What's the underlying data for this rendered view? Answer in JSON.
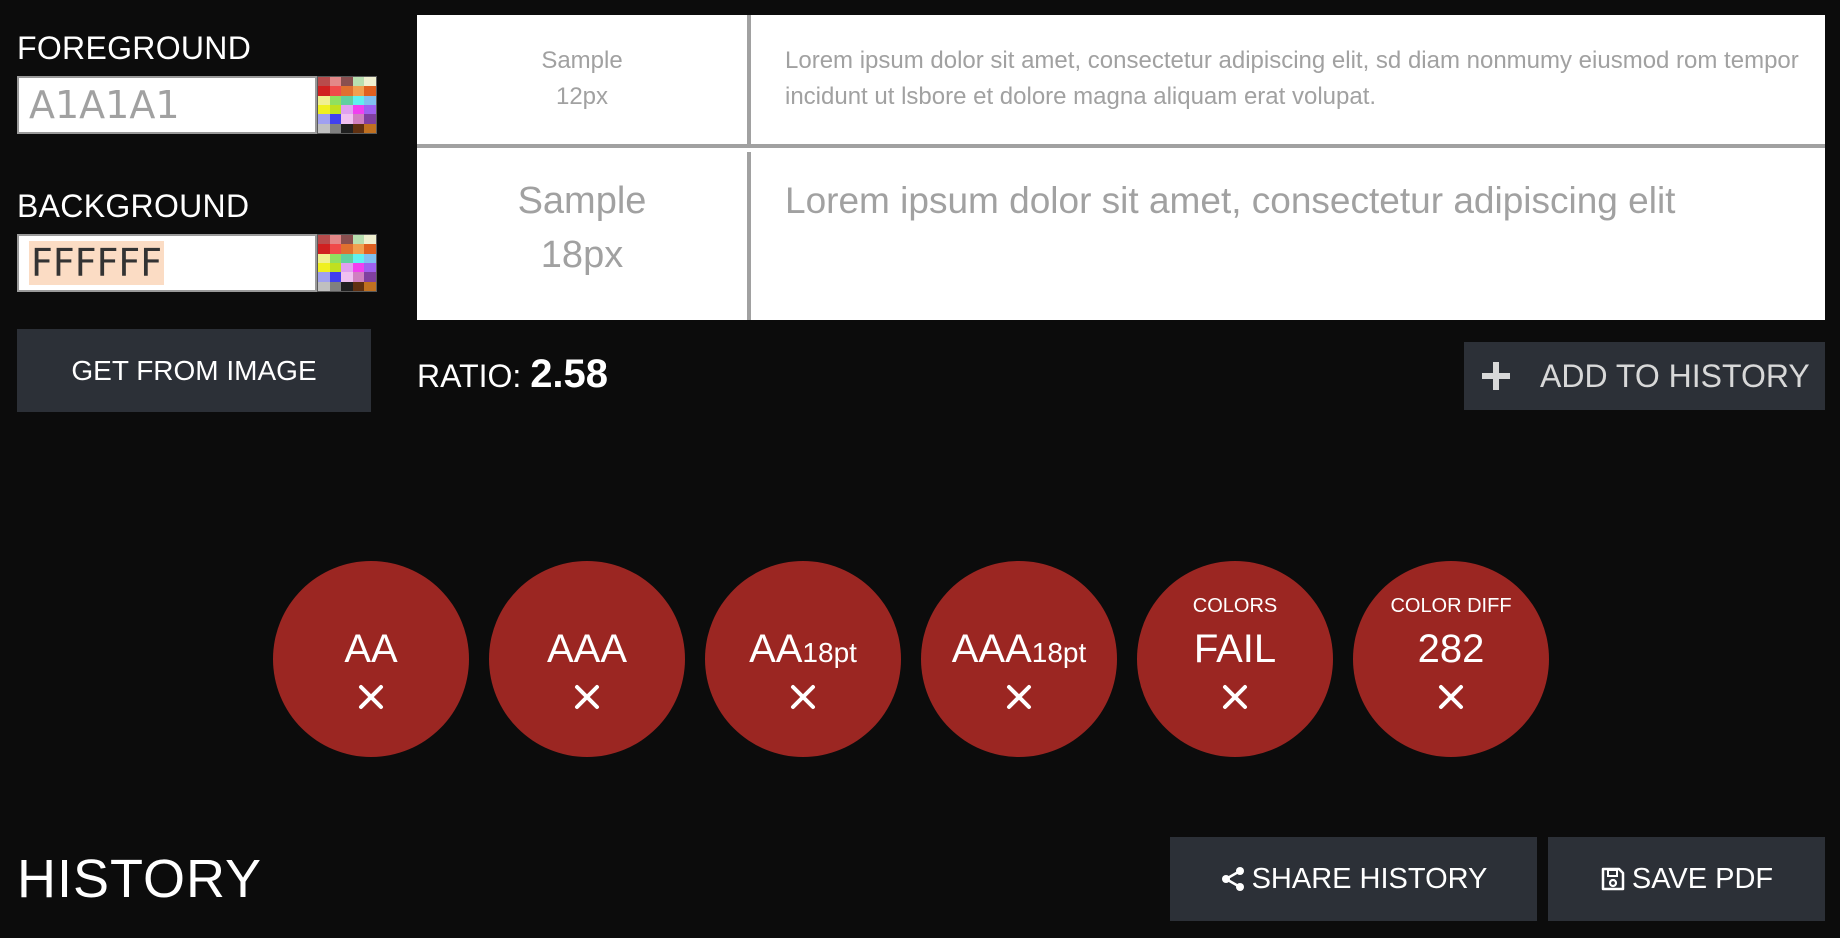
{
  "foreground": {
    "label": "FOREGROUND",
    "value": "A1A1A1"
  },
  "background": {
    "label": "BACKGROUND",
    "value": "FFFFFF"
  },
  "get_from_image_label": "GET FROM IMAGE",
  "samples": {
    "small": {
      "label_line1": "Sample",
      "label_line2": "12px",
      "text": "Lorem ipsum dolor sit amet, consectetur adipiscing elit, sd diam nonmumy eiusmod rom tempor incidunt ut lsbore et dolore magna aliquam erat volupat."
    },
    "large": {
      "label_line1": "Sample",
      "label_line2": "18px",
      "text": "Lorem ipsum dolor sit amet, consectetur adipiscing elit"
    }
  },
  "ratio": {
    "label": "RATIO:",
    "value": "2.58"
  },
  "add_history_label": "ADD TO HISTORY",
  "results": [
    {
      "main": "AA",
      "sub": "",
      "small": "",
      "status_icon": "x-icon"
    },
    {
      "main": "AAA",
      "sub": "",
      "small": "",
      "status_icon": "x-icon"
    },
    {
      "main": "AA",
      "sub": "18pt",
      "small": "",
      "status_icon": "x-icon"
    },
    {
      "main": "AAA",
      "sub": "18pt",
      "small": "",
      "status_icon": "x-icon"
    },
    {
      "main": "FAIL",
      "sub": "",
      "small": "COLORS",
      "status_icon": "x-icon"
    },
    {
      "main": "282",
      "sub": "",
      "small": "COLOR DIFF",
      "status_icon": "x-icon"
    }
  ],
  "history": {
    "title": "HISTORY",
    "share_label": "SHARE HISTORY",
    "save_pdf_label": "SAVE PDF"
  },
  "colors": {
    "page_bg": "#0c0c0c",
    "button_bg": "#2c3037",
    "fail_red": "#9b2622",
    "sample_text": "#a1a1a1",
    "highlight": "#fbdcc4"
  },
  "palette_swatches": [
    "#b84c4c",
    "#e38888",
    "#8a4f4f",
    "#b8e0b0",
    "#f0f0d0",
    "#d02020",
    "#f04a4a",
    "#e07030",
    "#f0a050",
    "#e06020",
    "#f0f090",
    "#90e060",
    "#60d0a0",
    "#60f0f0",
    "#80c0f0",
    "#f0f020",
    "#c0e020",
    "#e0a0f0",
    "#f040f0",
    "#a060f0",
    "#a0a0f0",
    "#4040f0",
    "#f0c0f0",
    "#d080c0",
    "#8040a0",
    "#c0c0c0",
    "#808080",
    "#202020",
    "#603010",
    "#c07020"
  ]
}
